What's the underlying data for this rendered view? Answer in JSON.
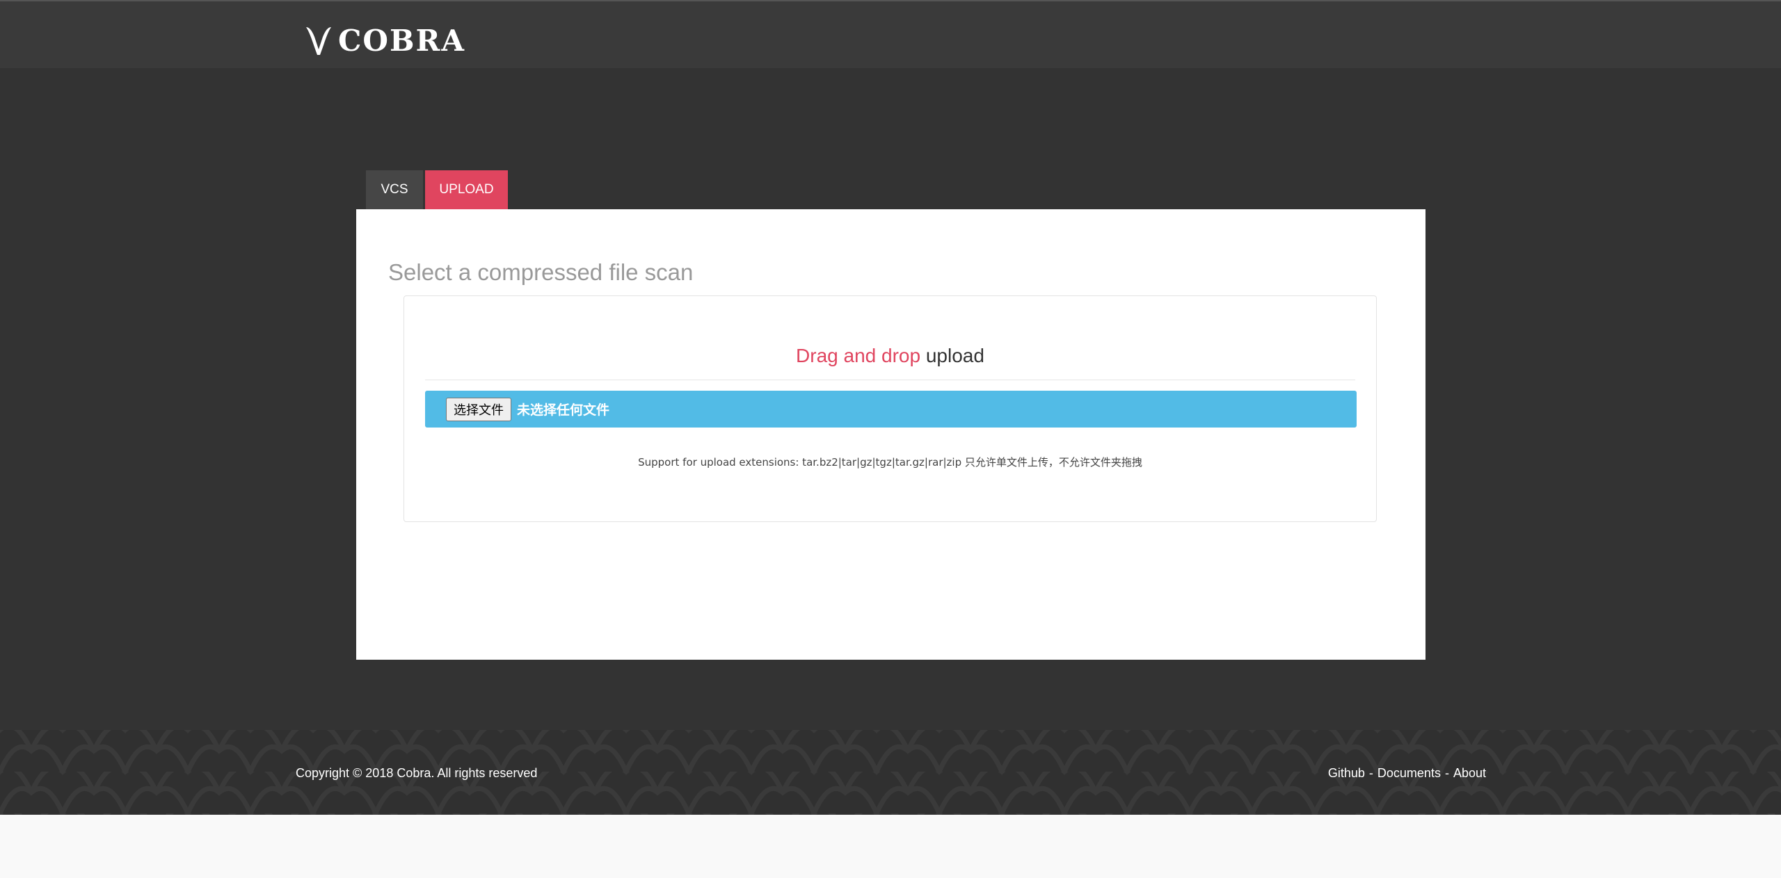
{
  "header": {
    "brand": "COBRA",
    "logo_icon": "cobra-logo-icon"
  },
  "tabs": [
    {
      "label": "VCS",
      "active": false
    },
    {
      "label": "UPLOAD",
      "active": true
    }
  ],
  "upload": {
    "title": "Select a compressed file scan",
    "drop_accent": "Drag and drop",
    "drop_rest": " upload",
    "file_button_label": "选择文件",
    "file_status": "未选择任何文件",
    "support_text": "Support for upload extensions: tar.bz2|tar|gz|tgz|tar.gz|rar|zip 只允许单文件上传，不允许文件夹拖拽"
  },
  "footer": {
    "copyright": "Copyright © 2018 Cobra. All rights reserved",
    "links": [
      "Github",
      "Documents",
      "About"
    ],
    "separator": "-"
  },
  "colors": {
    "header_bg": "#3a3a3a",
    "main_bg": "#333333",
    "accent_red": "#e0455f",
    "file_bar_blue": "#52bbe6"
  }
}
